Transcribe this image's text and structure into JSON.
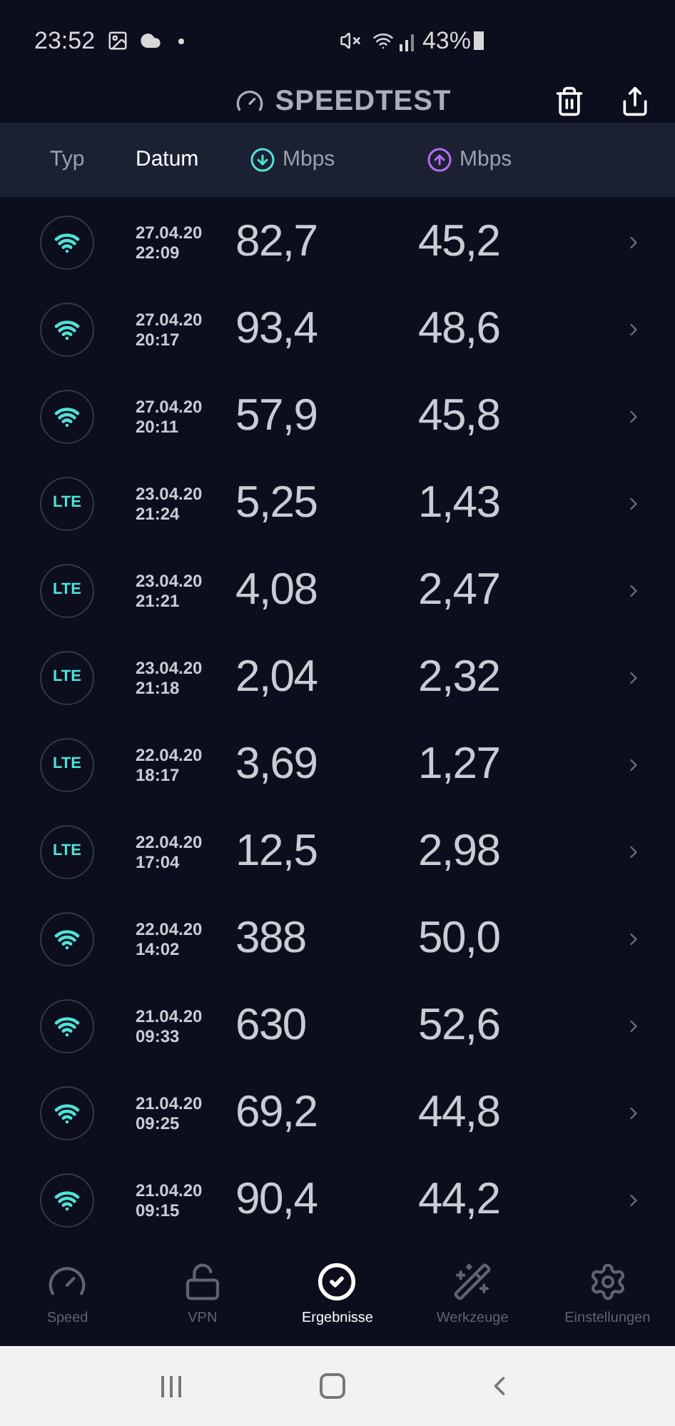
{
  "status_bar": {
    "time": "23:52",
    "battery": "43%"
  },
  "header": {
    "title": "SPEEDTEST"
  },
  "columns": {
    "type": "Typ",
    "date": "Datum",
    "download": "Mbps",
    "upload": "Mbps"
  },
  "rows": [
    {
      "kind": "wifi",
      "date": "27.04.20",
      "time": "22:09",
      "download": "82,7",
      "upload": "45,2"
    },
    {
      "kind": "wifi",
      "date": "27.04.20",
      "time": "20:17",
      "download": "93,4",
      "upload": "48,6"
    },
    {
      "kind": "wifi",
      "date": "27.04.20",
      "time": "20:11",
      "download": "57,9",
      "upload": "45,8"
    },
    {
      "kind": "lte",
      "label": "LTE",
      "date": "23.04.20",
      "time": "21:24",
      "download": "5,25",
      "upload": "1,43"
    },
    {
      "kind": "lte",
      "label": "LTE",
      "date": "23.04.20",
      "time": "21:21",
      "download": "4,08",
      "upload": "2,47"
    },
    {
      "kind": "lte",
      "label": "LTE",
      "date": "23.04.20",
      "time": "21:18",
      "download": "2,04",
      "upload": "2,32"
    },
    {
      "kind": "lte",
      "label": "LTE",
      "date": "22.04.20",
      "time": "18:17",
      "download": "3,69",
      "upload": "1,27"
    },
    {
      "kind": "lte",
      "label": "LTE",
      "date": "22.04.20",
      "time": "17:04",
      "download": "12,5",
      "upload": "2,98"
    },
    {
      "kind": "wifi",
      "date": "22.04.20",
      "time": "14:02",
      "download": "388",
      "upload": "50,0"
    },
    {
      "kind": "wifi",
      "date": "21.04.20",
      "time": "09:33",
      "download": "630",
      "upload": "52,6"
    },
    {
      "kind": "wifi",
      "date": "21.04.20",
      "time": "09:25",
      "download": "69,2",
      "upload": "44,8"
    },
    {
      "kind": "wifi",
      "date": "21.04.20",
      "time": "09:15",
      "download": "90,4",
      "upload": "44,2"
    }
  ],
  "tabs": [
    {
      "kind": "speed",
      "label": "Speed",
      "selected": false
    },
    {
      "kind": "vpn",
      "label": "VPN",
      "selected": false
    },
    {
      "kind": "results",
      "label": "Ergebnisse",
      "selected": true
    },
    {
      "kind": "tools",
      "label": "Werkzeuge",
      "selected": false
    },
    {
      "kind": "settings",
      "label": "Einstellungen",
      "selected": false
    }
  ]
}
